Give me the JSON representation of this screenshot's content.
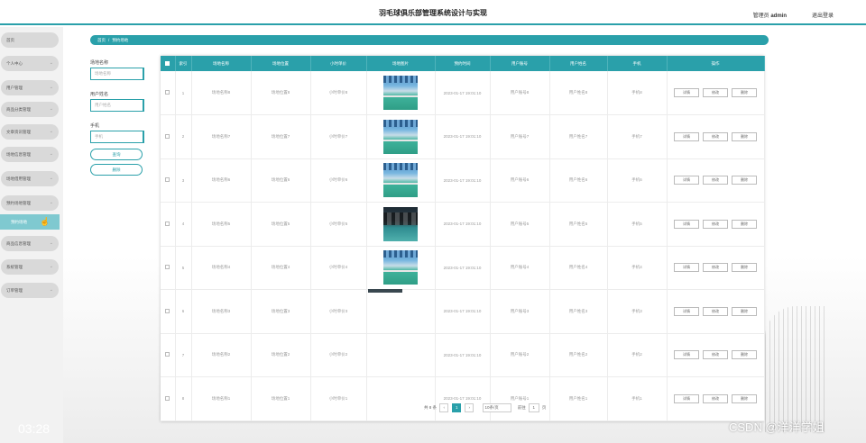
{
  "header": {
    "title": "羽毛球俱乐部管理系统设计与实现",
    "role": "管理员",
    "username": "admin",
    "logout": "退出登录"
  },
  "sidebar": {
    "items": [
      {
        "label": "首页",
        "chev": ""
      },
      {
        "label": "个人中心",
        "chev": "⌄"
      },
      {
        "label": "用户管理",
        "chev": "⌄"
      },
      {
        "label": "商品分类管理",
        "chev": "⌄"
      },
      {
        "label": "文章资讯管理",
        "chev": "⌄"
      },
      {
        "label": "场地信息管理",
        "chev": "⌄"
      },
      {
        "label": "场地借用管理",
        "chev": "⌄"
      },
      {
        "label": "预约场地管理",
        "chev": "⌄"
      },
      {
        "label": "商品信息管理",
        "chev": "⌄"
      },
      {
        "label": "系统管理",
        "chev": "⌄"
      },
      {
        "label": "订单管理",
        "chev": "⌄"
      }
    ],
    "active_sub": "预约场地"
  },
  "clock": "03:28",
  "breadcrumb": {
    "home": "首页",
    "sep": "/",
    "current": "预约场地"
  },
  "search": {
    "field1_label": "场地名称",
    "field1_placeholder": "场地名称",
    "field2_label": "用户姓名",
    "field2_placeholder": "用户姓名",
    "field3_label": "手机",
    "field3_placeholder": "手机",
    "search_btn": "查询",
    "delete_btn": "删除"
  },
  "table": {
    "headers": [
      "索引",
      "场地名称",
      "场地位置",
      "小时单价",
      "场地图片",
      "预约时间",
      "用户账号",
      "用户姓名",
      "手机",
      "操作"
    ],
    "actions": {
      "detail": "详情",
      "edit": "修改",
      "delete": "删除"
    },
    "rows": [
      {
        "idx": "1",
        "name": "场地名称8",
        "loc": "场地位置8",
        "price": "小时单价8",
        "img": "hall",
        "time": "2023-01-17 19:01:10",
        "account": "用户账号8",
        "uname": "用户姓名8",
        "phone": "手机8"
      },
      {
        "idx": "2",
        "name": "场地名称7",
        "loc": "场地位置7",
        "price": "小时单价7",
        "img": "hall",
        "time": "2023-01-17 19:01:10",
        "account": "用户账号7",
        "uname": "用户姓名7",
        "phone": "手机7"
      },
      {
        "idx": "3",
        "name": "场地名称6",
        "loc": "场地位置6",
        "price": "小时单价6",
        "img": "hall",
        "time": "2023-01-17 19:01:10",
        "account": "用户账号6",
        "uname": "用户姓名6",
        "phone": "手机6"
      },
      {
        "idx": "4",
        "name": "场地名称5",
        "loc": "场地位置5",
        "price": "小时单价5",
        "img": "dark",
        "time": "2023-01-17 19:01:10",
        "account": "用户账号5",
        "uname": "用户姓名5",
        "phone": "手机5"
      },
      {
        "idx": "5",
        "name": "场地名称4",
        "loc": "场地位置4",
        "price": "小时单价4",
        "img": "hall",
        "time": "2023-01-17 19:01:10",
        "account": "用户账号4",
        "uname": "用户姓名4",
        "phone": "手机4"
      },
      {
        "idx": "6",
        "name": "场地名称3",
        "loc": "场地位置3",
        "price": "小时单价3",
        "img": "strip",
        "time": "2023-01-17 19:01:10",
        "account": "用户账号3",
        "uname": "用户姓名3",
        "phone": "手机3"
      },
      {
        "idx": "7",
        "name": "场地名称2",
        "loc": "场地位置2",
        "price": "小时单价2",
        "img": "",
        "time": "2023-01-17 19:01:10",
        "account": "用户账号2",
        "uname": "用户姓名2",
        "phone": "手机2"
      },
      {
        "idx": "8",
        "name": "场地名称1",
        "loc": "场地位置1",
        "price": "小时单价1",
        "img": "",
        "time": "2023-01-17 19:01:10",
        "account": "用户账号1",
        "uname": "用户姓名1",
        "phone": "手机1"
      }
    ]
  },
  "pager": {
    "total": "共 8 条",
    "prev": "‹",
    "page": "1",
    "next": "›",
    "page_size": "10条/页",
    "goto_label": "前往",
    "goto_value": "1",
    "goto_suffix": "页"
  },
  "watermark": "CSDN @洋洋学姐",
  "colors": {
    "accent": "#2aa0aa",
    "active_sub": "#7fc9d0"
  }
}
